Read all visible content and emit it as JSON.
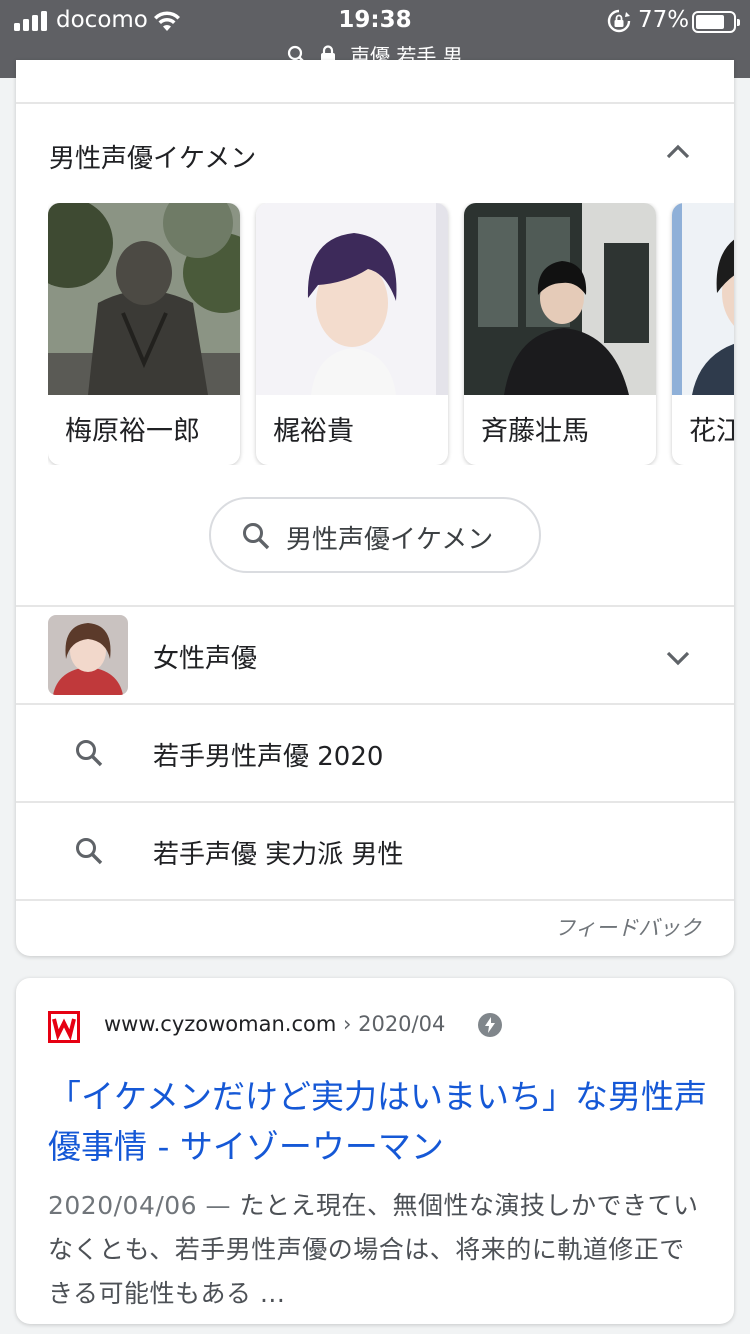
{
  "status_bar": {
    "carrier": "docomo",
    "time": "19:38",
    "battery_percent": "77%",
    "battery_level": 0.77,
    "url": "声優 若手 男"
  },
  "section": {
    "title": "男性声優イケメン",
    "people": [
      {
        "name": "梅原裕一郎"
      },
      {
        "name": "梶裕貴"
      },
      {
        "name": "斉藤壮馬"
      },
      {
        "name": "花江"
      }
    ],
    "search_chip": "男性声優イケメン"
  },
  "related": [
    {
      "label": "女性声優",
      "type": "expandable",
      "icon": "avatar"
    },
    {
      "label": "若手男性声優 2020",
      "type": "search",
      "icon": "search-icon"
    },
    {
      "label": "若手声優 実力派 男性",
      "type": "search",
      "icon": "search-icon"
    }
  ],
  "feedback": "フィードバック",
  "result": {
    "site": "www.cyzowoman.com",
    "breadcrumb_sep": "›",
    "breadcrumb_date": "2020/04",
    "title": "「イケメンだけど実力はいまいち」な男性声優事情 - サイゾーウーマン",
    "snippet_date": "2020/04/06 —",
    "snippet": "たとえ現在、無個性な演技しかできていなくとも、若手男性声優の場合は、将来的に軌道修正できる可能性もある ...",
    "favicon_color": "#e60012",
    "link_color": "#1558d6"
  }
}
